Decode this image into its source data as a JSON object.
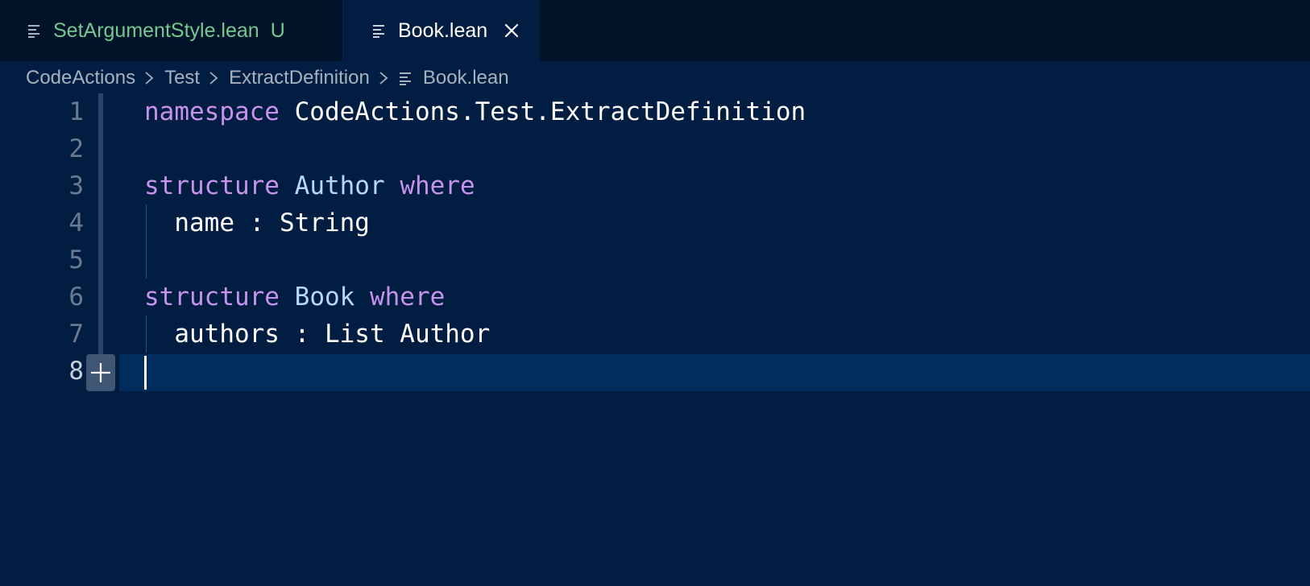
{
  "tabs": [
    {
      "label": "SetArgumentStyle.lean",
      "badge": "U",
      "icon": "file-lines-icon",
      "active": false
    },
    {
      "label": "Book.lean",
      "icon": "file-lines-icon",
      "close_icon": "close-icon",
      "active": true
    }
  ],
  "breadcrumb": [
    "CodeActions",
    "Test",
    "ExtractDefinition",
    "Book.lean"
  ],
  "editor": {
    "line_numbers": [
      "1",
      "2",
      "3",
      "4",
      "5",
      "6",
      "7",
      "8"
    ],
    "lines": [
      [
        {
          "t": "namespace",
          "k": "kw"
        },
        {
          "t": " CodeActions.Test.ExtractDefinition",
          "k": "plain"
        }
      ],
      [],
      [
        {
          "t": "structure",
          "k": "kw"
        },
        {
          "t": " ",
          "k": "plain"
        },
        {
          "t": "Author",
          "k": "ty"
        },
        {
          "t": " ",
          "k": "plain"
        },
        {
          "t": "where",
          "k": "kw"
        }
      ],
      [
        {
          "t": "  name : String",
          "k": "plain"
        }
      ],
      [],
      [
        {
          "t": "structure",
          "k": "kw"
        },
        {
          "t": " ",
          "k": "plain"
        },
        {
          "t": "Book",
          "k": "ty"
        },
        {
          "t": " ",
          "k": "plain"
        },
        {
          "t": "where",
          "k": "kw"
        }
      ],
      [
        {
          "t": "  authors : List Author",
          "k": "plain"
        }
      ],
      []
    ],
    "current_line": "8",
    "gutter_action_icon": "plus-icon"
  },
  "colors": {
    "background": "#011d42",
    "tabbar": "#011328",
    "keyword": "#c792ea",
    "type": "#b8d7ff",
    "untracked": "#73c991"
  }
}
